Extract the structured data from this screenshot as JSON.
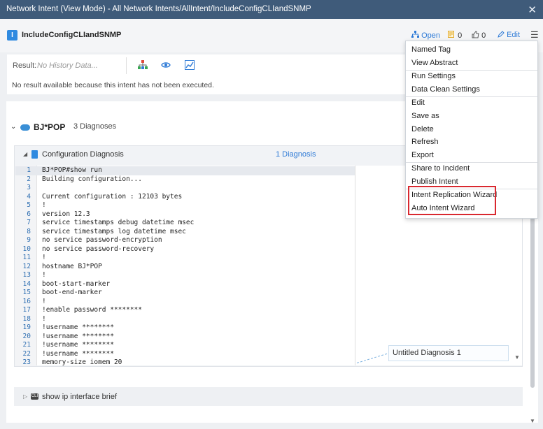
{
  "window": {
    "title": "Network Intent (View Mode) - All Network Intents/AllIntent/IncludeConfigCLIandSNMP",
    "close_glyph": "✕"
  },
  "header": {
    "icon_letter": "I",
    "intent_name": "IncludeConfigCLIandSNMP",
    "open_label": "Open",
    "comments_count": "0",
    "likes_count": "0",
    "edit_label": "Edit",
    "menu_glyph": "☰"
  },
  "result": {
    "label": "Result:",
    "value_placeholder": "No History Data...",
    "message": "No result available because this intent has not been executed."
  },
  "device": {
    "name": "BJ*POP",
    "diagnoses": "3 Diagnoses"
  },
  "config_section": {
    "title": "Configuration Diagnosis",
    "diagnosis_count": "1 Diagnosis",
    "lines": [
      {
        "n": "1",
        "t": "BJ*POP#show run"
      },
      {
        "n": "2",
        "t": "Building configuration..."
      },
      {
        "n": "3",
        "t": ""
      },
      {
        "n": "4",
        "t": "Current configuration : 12103 bytes"
      },
      {
        "n": "5",
        "t": "!"
      },
      {
        "n": "6",
        "t": "version 12.3"
      },
      {
        "n": "7",
        "t": "service timestamps debug datetime msec"
      },
      {
        "n": "8",
        "t": "service timestamps log datetime msec"
      },
      {
        "n": "9",
        "t": "no service password-encryption"
      },
      {
        "n": "10",
        "t": "no service password-recovery"
      },
      {
        "n": "11",
        "t": "!"
      },
      {
        "n": "12",
        "t": "hostname BJ*POP"
      },
      {
        "n": "13",
        "t": "!"
      },
      {
        "n": "14",
        "t": "boot-start-marker"
      },
      {
        "n": "15",
        "t": "boot-end-marker"
      },
      {
        "n": "16",
        "t": "!"
      },
      {
        "n": "17",
        "t": "!enable password ********"
      },
      {
        "n": "18",
        "t": "!"
      },
      {
        "n": "19",
        "t": "!username ********"
      },
      {
        "n": "20",
        "t": "!username ********"
      },
      {
        "n": "21",
        "t": "!username ********"
      },
      {
        "n": "22",
        "t": "!username ********"
      },
      {
        "n": "23",
        "t": "memory-size iomem 20"
      }
    ],
    "diagnosis_box_label": "Untitled Diagnosis 1"
  },
  "show_section": {
    "icon_text": "CLI",
    "label": "show ip interface brief"
  },
  "menu": {
    "items": [
      "Named Tag",
      "View Abstract",
      "Run Settings",
      "Data Clean Settings",
      "Edit",
      "Save as",
      "Delete",
      "Refresh",
      "Export",
      "Share to Incident",
      "Publish Intent",
      "Intent Replication Wizard",
      "Auto Intent Wizard"
    ]
  },
  "colors": {
    "titlebar": "#3f5b7a",
    "accent": "#2f7bd6",
    "highlight": "#d9282f"
  }
}
